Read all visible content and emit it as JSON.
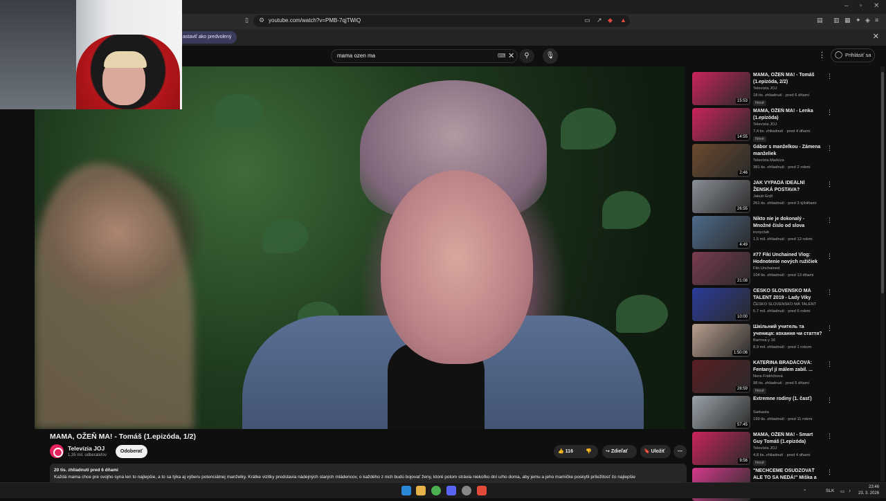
{
  "browser": {
    "url": "youtube.com/watch?v=PMB-7qjTWiQ",
    "infobar_text": "astaviť ako predvolený"
  },
  "masthead": {
    "search_value": "mama ozen ma",
    "signin_label": "Prihlásiť sa"
  },
  "video": {
    "title": "MAMA, OŽEŇ MA! - Tomáš (1.epizóda, 1/2)",
    "channel": "Televízia JOJ",
    "subscribers": "1,35 mil. odberateľov",
    "subscribe_label": "Odoberať",
    "likes": "116",
    "share_label": "Zdieľať",
    "save_label": "Uložiť",
    "desc_meta": "20 tis. zhliadnutí  pred 6 dňami",
    "desc_text": "Každá mama chce pre svojho syna len to najlepšie, a to sa týka aj výberu potenciálnej manželky. Krátke vizitky predstavia nádejných starých mládencov, o každého z nich budú bojovať ženy, ktoré potom strávia niekoľko dní u/ho doma, aby jemu a jeho mamičke poskytli príležitosť čo najlepšie"
  },
  "recommendations": [
    {
      "title": "MAMA, OŽEŇ MA! - Tomáš (1.epizóda, 2/2)",
      "channel": "Televízia JOJ",
      "meta": "18 tis. zhliadnutí · pred 6 dňami",
      "badge": "Nové",
      "duration": "15:53",
      "color": "#c9245a"
    },
    {
      "title": "MAMA, OŽEŇ MA! - Lenka (1.epizóda)",
      "channel": "Televízia JOJ",
      "meta": "7,4 tis. zhliadnutí · pred 4 dňami",
      "badge": "Nové",
      "duration": "14:55",
      "color": "#c9245a"
    },
    {
      "title": "Gábor s manželkou - Zámena manželiek",
      "channel": "Televízia Markíza",
      "meta": "381 tis. zhliadnutí · pred 2 rokmi",
      "badge": "",
      "duration": "2:46",
      "color": "#6b4a2e"
    },
    {
      "title": "JAK VYPADÁ IDEÁLNÍ ŽENSKÁ POSTAVA?",
      "channel": "Jakub Enžl",
      "meta": "261 tis. zhliadnutí · pred 3 týždňami",
      "badge": "",
      "duration": "26:55",
      "color": "#8a8f96"
    },
    {
      "title": "Nikto nie je dokonalý - Množné číslo od slova \"človek\"",
      "channel": "ironyclub",
      "meta": "1,5 mil. zhliadnutí · pred 12 rokmi",
      "badge": "",
      "duration": "4:49",
      "color": "#4d6b8a"
    },
    {
      "title": "#77 Fiki Unchained Vlog: Hodnotenie nových ružičiek",
      "channel": "Fiki Unchained",
      "meta": "104 tis. zhliadnutí · pred 13 dňami",
      "badge": "",
      "duration": "21:08",
      "color": "#7a3c4e"
    },
    {
      "title": "ČESKO SLOVENSKO MÁ TALENT 2019 - Lady Viky (Dia...",
      "channel": "ČESKO SLOVENSKO MÁ TALENT",
      "meta": "5,7 mil. zhliadnutí · pred 6 rokmi",
      "badge": "",
      "duration": "10:00",
      "color": "#2a3c9a"
    },
    {
      "title": "Шкільний учитель та учениця: кохання чи стаття? – Вагітна...",
      "channel": "Вагітна у 16",
      "meta": "8,9 mil. zhliadnutí · pred 1 rokom",
      "badge": "",
      "duration": "1:50:06",
      "color": "#b89f8e"
    },
    {
      "title": "KATEŘINA BRADÁČOVÁ: Fentanyl jí málem zabil. ...",
      "channel": "Nora Fridrichová",
      "meta": "98 tis. zhliadnutí · pred 5 dňami",
      "badge": "Nové",
      "duration": "28:59",
      "color": "#5a1e22"
    },
    {
      "title": "Extremne rodiny (1. časť)",
      "channel": "Sarkasta",
      "meta": "199 tis. zhliadnutí · pred 11 rokmi",
      "badge": "",
      "duration": "57:45",
      "color": "#9aa2a8"
    },
    {
      "title": "MAMA, OŽEŇ MA! - Smart Guy Tomáš (1.epizóda)",
      "channel": "Televízia JOJ",
      "meta": "4,8 tis. zhliadnutí · pred 4 dňami",
      "badge": "Nové",
      "duration": "9:56",
      "color": "#c9245a"
    },
    {
      "title": "\"NECHCEME OSUDZOVAŤ ALE TO SA NEDÁ!\" Miška a Heidi z ...",
      "channel": "",
      "meta": "",
      "badge": "",
      "duration": "",
      "color": "#d23a8a"
    }
  ],
  "taskbar": {
    "lang": "SLK",
    "time": "23:46",
    "date": "23. 3. 2026"
  }
}
